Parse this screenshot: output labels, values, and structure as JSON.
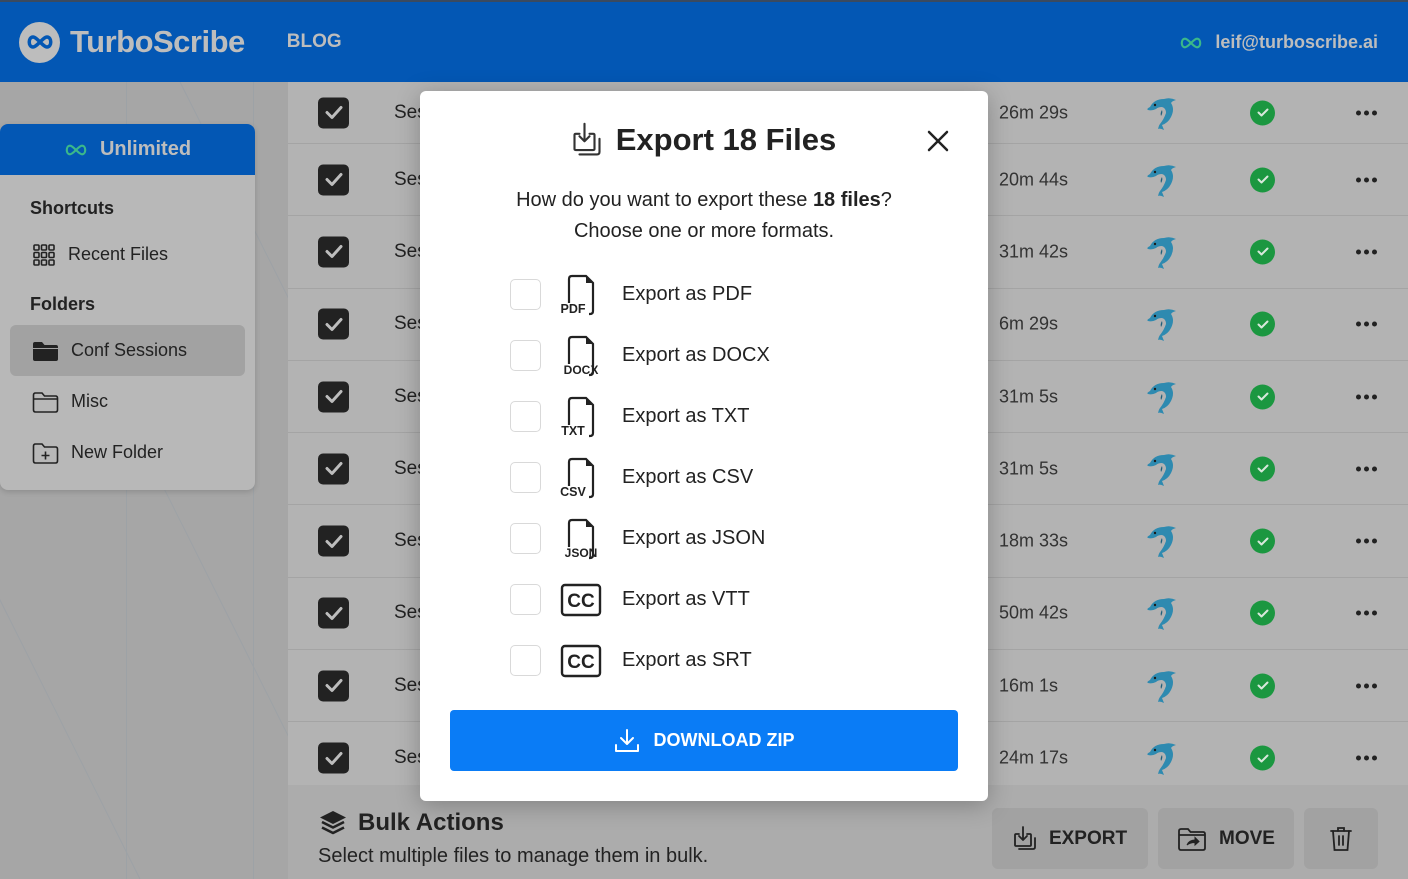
{
  "header": {
    "app_name": "TurboScribe",
    "nav_blog": "BLOG",
    "user_email": "leif@turboscribe.ai"
  },
  "sidebar": {
    "plan_label": "Unlimited",
    "shortcuts_title": "Shortcuts",
    "shortcuts": [
      {
        "label": "Recent Files",
        "icon": "grid-icon"
      }
    ],
    "folders_title": "Folders",
    "folders": [
      {
        "label": "Conf Sessions",
        "icon": "folder-filled-icon",
        "active": true
      },
      {
        "label": "Misc",
        "icon": "folder-icon",
        "active": false
      },
      {
        "label": "New Folder",
        "icon": "folder-plus-icon",
        "active": false
      }
    ]
  },
  "files": [
    {
      "name": "Ses",
      "duration": "26m 29s",
      "checked": true,
      "status": "complete"
    },
    {
      "name": "Ses",
      "duration": "20m 44s",
      "checked": true,
      "status": "complete"
    },
    {
      "name": "Ses",
      "duration": "31m 42s",
      "checked": true,
      "status": "complete"
    },
    {
      "name": "Ses",
      "duration": "6m 29s",
      "checked": true,
      "status": "complete"
    },
    {
      "name": "Ses",
      "duration": "31m 5s",
      "checked": true,
      "status": "complete"
    },
    {
      "name": "Ses",
      "duration": "31m 5s",
      "checked": true,
      "status": "complete"
    },
    {
      "name": "Ses",
      "duration": "18m 33s",
      "checked": true,
      "status": "complete"
    },
    {
      "name": "Ses",
      "duration": "50m 42s",
      "checked": true,
      "status": "complete"
    },
    {
      "name": "Ses",
      "duration": "16m 1s",
      "checked": true,
      "status": "complete"
    },
    {
      "name": "Ses",
      "duration": "24m 17s",
      "checked": true,
      "status": "complete"
    }
  ],
  "bulk": {
    "title": "Bulk Actions",
    "subtitle": "Select multiple files to manage them in bulk.",
    "export_label": "EXPORT",
    "move_label": "MOVE"
  },
  "modal": {
    "title": "Export 18 Files",
    "desc_prefix": "How do you want to export these ",
    "desc_bold": "18 files",
    "desc_suffix": "?",
    "desc_line2": "Choose one or more formats.",
    "options": [
      {
        "label": "Export as PDF",
        "icon_text": "PDF",
        "icon": "file-pdf-icon",
        "checked": false
      },
      {
        "label": "Export as DOCX",
        "icon_text": "DOCX",
        "icon": "file-docx-icon",
        "checked": false
      },
      {
        "label": "Export as TXT",
        "icon_text": "TXT",
        "icon": "file-txt-icon",
        "checked": false
      },
      {
        "label": "Export as CSV",
        "icon_text": "CSV",
        "icon": "file-csv-icon",
        "checked": false
      },
      {
        "label": "Export as JSON",
        "icon_text": "JSON",
        "icon": "file-json-icon",
        "checked": false
      },
      {
        "label": "Export as VTT",
        "icon_text": "CC",
        "icon": "closed-captions-icon",
        "checked": false
      },
      {
        "label": "Export as SRT",
        "icon_text": "CC",
        "icon": "closed-captions-icon",
        "checked": false
      }
    ],
    "download_label": "DOWNLOAD ZIP"
  },
  "colors": {
    "brand_blue": "#0357b4",
    "button_blue": "#0a7cf6",
    "success_green": "#1b9740",
    "infinity_green": "#3bb88a"
  }
}
